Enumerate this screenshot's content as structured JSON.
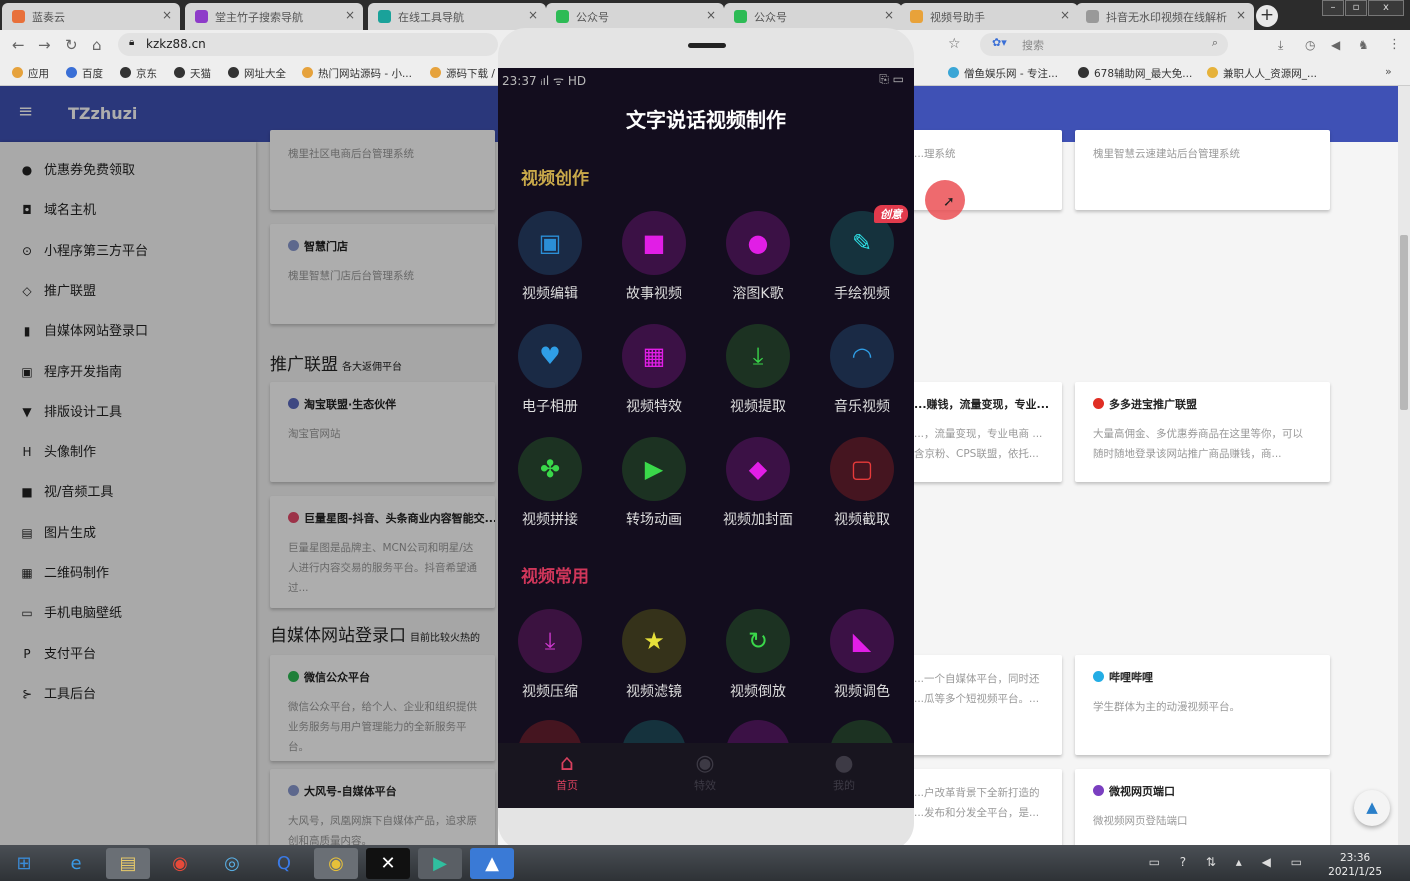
{
  "browser": {
    "tabs": [
      {
        "title": "蓝奏云",
        "color": "#e8703a"
      },
      {
        "title": "堂主竹子搜索导航",
        "color": "#8e3bc9"
      },
      {
        "title": "在线工具导航",
        "color": "#1aa29a"
      },
      {
        "title": "公众号",
        "color": "#2dbb55"
      },
      {
        "title": "公众号",
        "color": "#2dbb55"
      },
      {
        "title": "视频号助手",
        "color": "#e8a23a"
      },
      {
        "title": "抖音无水印视频在线解析",
        "color": "#999999"
      }
    ],
    "new_tab": "+",
    "window_controls": [
      "–",
      "▫",
      "x"
    ],
    "url": "kzkz88.cn",
    "search_placeholder": "搜索",
    "bookmarks": [
      "应用",
      "百度",
      "京东",
      "天猫",
      "网址大全",
      "热门网站源码 - 小...",
      "源码下载 /",
      "...",
      "僧鱼娱乐网 - 专注...",
      "678辅助网_最大免...",
      "兼职人人_资源网_..."
    ],
    "more": "»"
  },
  "site": {
    "brand": "TZzhuzi",
    "sidebar": [
      {
        "icon": "●",
        "label": "优惠券免费领取"
      },
      {
        "icon": "◘",
        "label": "域名主机"
      },
      {
        "icon": "⊙",
        "label": "小程序第三方平台"
      },
      {
        "icon": "◇",
        "label": "推广联盟"
      },
      {
        "icon": "▮",
        "label": "自媒体网站登录口"
      },
      {
        "icon": "▣",
        "label": "程序开发指南"
      },
      {
        "icon": "▼",
        "label": "排版设计工具"
      },
      {
        "icon": "H",
        "label": "头像制作"
      },
      {
        "icon": "■",
        "label": "视/音频工具"
      },
      {
        "icon": "▤",
        "label": "图片生成"
      },
      {
        "icon": "▦",
        "label": "二维码制作"
      },
      {
        "icon": "▭",
        "label": "手机电脑壁纸"
      },
      {
        "icon": "P",
        "label": "支付平台"
      },
      {
        "icon": "⊱",
        "label": "工具后台"
      }
    ],
    "sections": [
      {
        "title": "推广联盟",
        "sub": "各大返佣平台"
      },
      {
        "title": "自媒体网站登录口",
        "sub": "目前比较火热的"
      }
    ],
    "cards_left": [
      {
        "title": "",
        "desc": "槐里社区电商后台管理系统",
        "icon_color": ""
      },
      {
        "title": "智慧门店",
        "desc": "槐里智慧门店后台管理系统",
        "icon_color": "#8a9ad0"
      },
      {
        "title": "淘宝联盟·生态伙伴",
        "desc": "淘宝官网站",
        "icon_color": "#5c6bc0"
      },
      {
        "title": "巨量星图-抖音、头条商业内容智能交...",
        "desc": "巨量星图是品牌主、MCN公司和明星/达人进行内容交易的服务平台。抖音希望通过...",
        "icon_color": "#e64a6a"
      },
      {
        "title": "微信公众平台",
        "desc": "微信公众平台，给个人、企业和组织提供业务服务与用户管理能力的全新服务平台。",
        "icon_color": "#2dbb55"
      },
      {
        "title": "大风号-自媒体平台",
        "desc": "大风号，凤凰网旗下自媒体产品，追求原创和高质量内容。",
        "icon_color": "#8a9ad0"
      }
    ],
    "cards_mid": [
      {
        "title": "",
        "desc": "...理系统"
      },
      {
        "title": "...赚钱，流量变现，专业...",
        "desc": "...，流量变现，专业电商 ...含京粉、CPS联盟，依托..."
      },
      {
        "title": "",
        "desc": "...一个自媒体平台，同时还 ...瓜等多个短视频平台。..."
      },
      {
        "title": "",
        "desc": "...户改革背景下全新打造的 ...发布和分发全平台，是..."
      }
    ],
    "cards_right": [
      {
        "title": "",
        "desc": "槐里智慧云速建站后台管理系统",
        "icon_color": ""
      },
      {
        "title": "多多进宝推广联盟",
        "desc": "大量高佣金、多优惠券商品在这里等你，可以随时随地登录该网站推广商品赚钱，商...",
        "icon_color": "#e02e24"
      },
      {
        "title": "哔哩哔哩",
        "desc": "学生群体为主的动漫视频平台。",
        "icon_color": "#23ade5"
      },
      {
        "title": "微视网页端口",
        "desc": "微视频网页登陆端口",
        "icon_color": "#7a3fc0"
      }
    ],
    "back_to_top": "▲"
  },
  "phone": {
    "time": "23:37",
    "status_icons": "ᵢıl ᯤ HD",
    "status_right": "⎘ ▭",
    "title": "文字说话视频制作",
    "sections": [
      {
        "title": "视频创作",
        "color": "#c9a94a"
      },
      {
        "title": "视频常用",
        "color": "#d0365a"
      }
    ],
    "creation_tools": [
      {
        "label": "视频编辑",
        "icon": "▣",
        "fg": "#2b8fd6",
        "bg": "#1a2a45"
      },
      {
        "label": "故事视频",
        "icon": "■",
        "fg": "#e11ee6",
        "bg": "#3b1145"
      },
      {
        "label": "溶图K歌",
        "icon": "●",
        "fg": "#e11ee6",
        "bg": "#3b1145"
      },
      {
        "label": "手绘视频",
        "icon": "✎",
        "fg": "#2de0e6",
        "bg": "#15323d",
        "badge": "创意"
      },
      {
        "label": "电子相册",
        "icon": "♥",
        "fg": "#2f9ee6",
        "bg": "#1a2a45"
      },
      {
        "label": "视频特效",
        "icon": "▦",
        "fg": "#e11ee6",
        "bg": "#3b1145"
      },
      {
        "label": "视频提取",
        "icon": "⤓",
        "fg": "#3ad84a",
        "bg": "#1c3222"
      },
      {
        "label": "音乐视频",
        "icon": "◠",
        "fg": "#2f9ee6",
        "bg": "#1a2a45"
      },
      {
        "label": "视频拼接",
        "icon": "✤",
        "fg": "#3ad84a",
        "bg": "#1c3222"
      },
      {
        "label": "转场动画",
        "icon": "▶",
        "fg": "#3ad84a",
        "bg": "#1c3222"
      },
      {
        "label": "视频加封面",
        "icon": "◆",
        "fg": "#e11ee6",
        "bg": "#3b1145"
      },
      {
        "label": "视频截取",
        "icon": "▢",
        "fg": "#e63a3a",
        "bg": "#451520"
      }
    ],
    "common_tools": [
      {
        "label": "视频压缩",
        "icon": "⤓",
        "fg": "#d03ad0",
        "bg": "#3b1240"
      },
      {
        "label": "视频滤镜",
        "icon": "★",
        "fg": "#e6e03a",
        "bg": "#35321a"
      },
      {
        "label": "视频倒放",
        "icon": "↻",
        "fg": "#3ad84a",
        "bg": "#1c3222"
      },
      {
        "label": "视频调色",
        "icon": "◣",
        "fg": "#e11ee6",
        "bg": "#3b1145"
      }
    ],
    "partial_row_colors": [
      "#451520",
      "#15323d",
      "#3b1145",
      "#1c3222"
    ],
    "bottom_nav": [
      {
        "label": "首页",
        "icon": "⌂",
        "active": true
      },
      {
        "label": "特效",
        "icon": "◉",
        "active": false
      },
      {
        "label": "我的",
        "icon": "●",
        "active": false
      }
    ]
  },
  "taskbar": {
    "apps": [
      "start",
      "ie",
      "explorer",
      "chrome",
      "baidu-netdisk",
      "qq-browser",
      "chrome-alt",
      "capcut",
      "filmora",
      "app"
    ],
    "tray": "▭ ? ⇅ ▴ ◀ ▭",
    "time": "23:36",
    "date": "2021/1/25"
  }
}
